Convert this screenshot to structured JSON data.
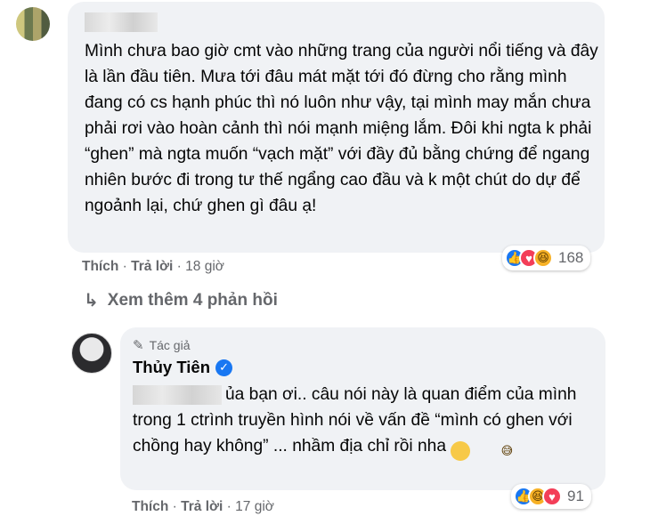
{
  "comment": {
    "text": "Mình chưa bao giờ cmt vào những trang của người nổi tiếng và đây là lần đầu tiên. Mưa tới đâu mát mặt tới đó đừng cho rằng mình đang có cs hạnh phúc thì nó luôn như vậy, tại mình may mắn chưa phải rơi vào hoàn cảnh thì nói mạnh miệng lắm. Đôi khi ngta k phải “ghen” mà ngta muốn “vạch mặt” với đầy đủ bằng chứng để ngang nhiên bước đi trong tư thế ngẩng cao đầu và k một chút do dự để ngoảnh lại, chứ ghen gì đâu ạ!",
    "reactions": {
      "icons": [
        "like-icon",
        "love-icon",
        "haha-icon"
      ],
      "count": "168"
    },
    "actions": {
      "like": "Thích",
      "reply": "Trả lời",
      "time": "18 giờ"
    }
  },
  "more_replies": "Xem thêm 4 phản hồi",
  "reply": {
    "author_badge": "Tác giả",
    "name": "Thủy Tiên",
    "text": "ủa bạn ơi.. câu nói này là quan điểm của mình trong 1 ctrình truyền hình nói về vấn đề “mình có ghen với chồng hay không” ... nhầm địa chỉ rồi nha",
    "reactions": {
      "icons": [
        "like-icon",
        "haha-icon",
        "love-icon"
      ],
      "count": "91"
    },
    "actions": {
      "like": "Thích",
      "reply": "Trả lời",
      "time": "17 giờ"
    }
  },
  "separator": "·"
}
